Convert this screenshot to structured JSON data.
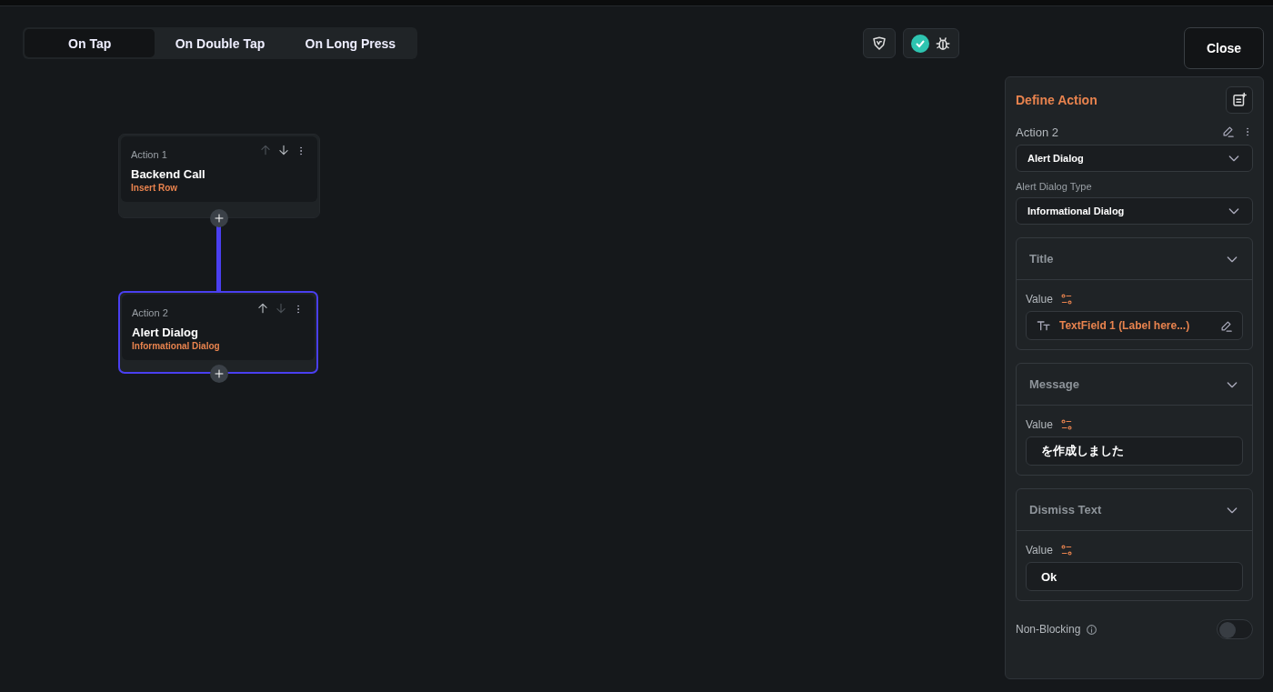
{
  "tabs": [
    {
      "label": "On Tap",
      "selected": true
    },
    {
      "label": "On Double Tap",
      "selected": false
    },
    {
      "label": "On Long Press",
      "selected": false
    }
  ],
  "validation": {
    "passed": true
  },
  "close_button": "Close",
  "actions": [
    {
      "index_label": "Action 1",
      "title": "Backend Call",
      "subtitle": "Insert Row",
      "selected": false,
      "up_disabled": true,
      "down_disabled": false
    },
    {
      "index_label": "Action 2",
      "title": "Alert Dialog",
      "subtitle": "Informational Dialog",
      "selected": true,
      "up_disabled": false,
      "down_disabled": true
    }
  ],
  "panel": {
    "title": "Define Action",
    "action_label": "Action 2",
    "action_type": "Alert Dialog",
    "dialog_type_label": "Alert Dialog Type",
    "dialog_type": "Informational Dialog",
    "sections": [
      {
        "title": "Title",
        "expanded": true,
        "value_label": "Value",
        "kind": "variable",
        "value": "TextField 1 (Label here...)"
      },
      {
        "title": "Message",
        "expanded": true,
        "value_label": "Value",
        "kind": "text",
        "value": "を作成しました"
      },
      {
        "title": "Dismiss Text",
        "expanded": true,
        "value_label": "Value",
        "kind": "text",
        "value": "Ok"
      }
    ],
    "non_blocking": {
      "label": "Non-Blocking",
      "on": false
    }
  }
}
